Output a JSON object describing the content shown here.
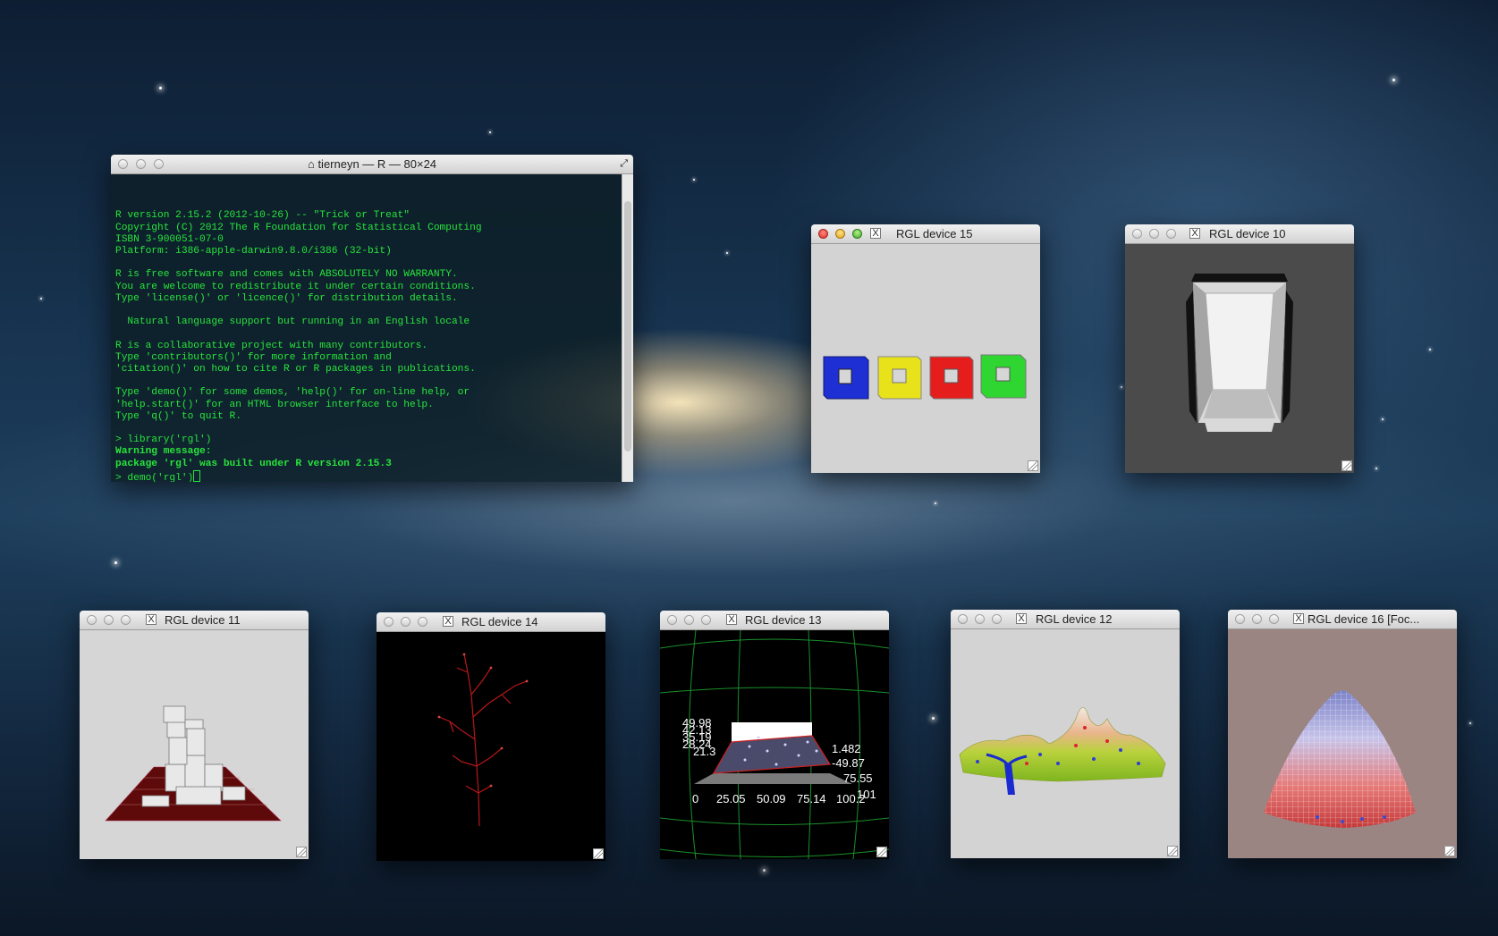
{
  "terminal": {
    "title": "tierneyn — R — 80×24",
    "lines": [
      "R version 2.15.2 (2012-10-26) -- \"Trick or Treat\"",
      "Copyright (C) 2012 The R Foundation for Statistical Computing",
      "ISBN 3-900051-07-0",
      "Platform: i386-apple-darwin9.8.0/i386 (32-bit)",
      "",
      "R is free software and comes with ABSOLUTELY NO WARRANTY.",
      "You are welcome to redistribute it under certain conditions.",
      "Type 'license()' or 'licence()' for distribution details.",
      "",
      "  Natural language support but running in an English locale",
      "",
      "R is a collaborative project with many contributors.",
      "Type 'contributors()' for more information and",
      "'citation()' on how to cite R or R packages in publications.",
      "",
      "Type 'demo()' for some demos, 'help()' for on-line help, or",
      "'help.start()' for an HTML browser interface to help.",
      "Type 'q()' to quit R.",
      "",
      "> library('rgl')"
    ],
    "warning_line1": "Warning message:",
    "warning_line2": "package 'rgl' was built under R version 2.15.3",
    "prompt_line": "> demo('rgl')"
  },
  "devices": {
    "d15": {
      "title": "RGL device 15"
    },
    "d10": {
      "title": "RGL device 10"
    },
    "d11": {
      "title": "RGL device 11"
    },
    "d14": {
      "title": "RGL device 14"
    },
    "d13": {
      "title": "RGL device 13",
      "x_ticks": [
        "0",
        "25.05",
        "50.09",
        "75.14",
        "100.2"
      ],
      "y_ticks": [
        "49.98",
        "42.13",
        "35.19",
        "28.24",
        "21.3"
      ],
      "z_ticks": [
        "1.482",
        "-49.87",
        "75.55",
        "101"
      ]
    },
    "d12": {
      "title": "RGL device 12"
    },
    "d16": {
      "title": "RGL device 16 [Foc..."
    }
  }
}
